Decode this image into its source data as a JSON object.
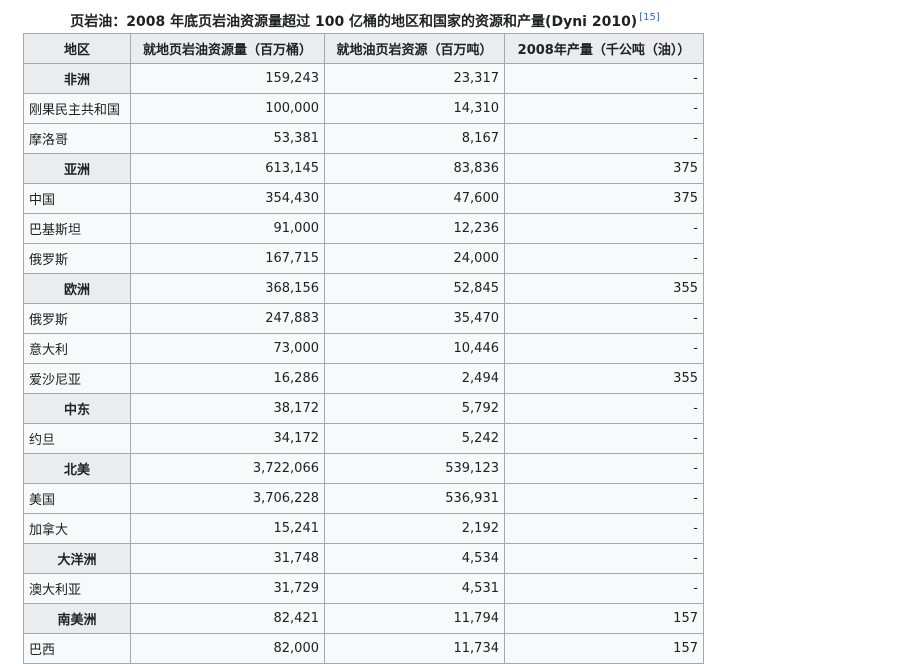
{
  "caption": {
    "text": "页岩油：2008 年底页岩油资源量超过 100 亿桶的地区和国家的资源和产量(Dyni 2010)",
    "ref": "[15]"
  },
  "table": {
    "headers": [
      "地区",
      "就地页岩油资源量（百万桶）",
      "就地油页岩资源（百万吨）",
      "2008年产量（千公吨（油））"
    ],
    "rows": [
      {
        "name": "非洲",
        "barrels": "159,243",
        "tons": "23,317",
        "production": "-",
        "is_region": true
      },
      {
        "name": "刚果民主共和国",
        "barrels": "100,000",
        "tons": "14,310",
        "production": "-",
        "is_region": false
      },
      {
        "name": "摩洛哥",
        "barrels": "53,381",
        "tons": "8,167",
        "production": "-",
        "is_region": false
      },
      {
        "name": "亚洲",
        "barrels": "613,145",
        "tons": "83,836",
        "production": "375",
        "is_region": true
      },
      {
        "name": "中国",
        "barrels": "354,430",
        "tons": "47,600",
        "production": "375",
        "is_region": false
      },
      {
        "name": "巴基斯坦",
        "barrels": "91,000",
        "tons": "12,236",
        "production": "-",
        "is_region": false
      },
      {
        "name": "俄罗斯",
        "barrels": "167,715",
        "tons": "24,000",
        "production": "-",
        "is_region": false
      },
      {
        "name": "欧洲",
        "barrels": "368,156",
        "tons": "52,845",
        "production": "355",
        "is_region": true
      },
      {
        "name": "俄罗斯",
        "barrels": "247,883",
        "tons": "35,470",
        "production": "-",
        "is_region": false
      },
      {
        "name": "意大利",
        "barrels": "73,000",
        "tons": "10,446",
        "production": "-",
        "is_region": false
      },
      {
        "name": "爱沙尼亚",
        "barrels": "16,286",
        "tons": "2,494",
        "production": "355",
        "is_region": false
      },
      {
        "name": "中东",
        "barrels": "38,172",
        "tons": "5,792",
        "production": "-",
        "is_region": true
      },
      {
        "name": "约旦",
        "barrels": "34,172",
        "tons": "5,242",
        "production": "-",
        "is_region": false
      },
      {
        "name": "北美",
        "barrels": "3,722,066",
        "tons": "539,123",
        "production": "-",
        "is_region": true
      },
      {
        "name": "美国",
        "barrels": "3,706,228",
        "tons": "536,931",
        "production": "-",
        "is_region": false
      },
      {
        "name": "加拿大",
        "barrels": "15,241",
        "tons": "2,192",
        "production": "-",
        "is_region": false
      },
      {
        "name": "大洋洲",
        "barrels": "31,748",
        "tons": "4,534",
        "production": "-",
        "is_region": true
      },
      {
        "name": "澳大利亚",
        "barrels": "31,729",
        "tons": "4,531",
        "production": "-",
        "is_region": false
      },
      {
        "name": "南美洲",
        "barrels": "82,421",
        "tons": "11,794",
        "production": "157",
        "is_region": true
      },
      {
        "name": "巴西",
        "barrels": "82,000",
        "tons": "11,734",
        "production": "157",
        "is_region": false
      }
    ]
  }
}
